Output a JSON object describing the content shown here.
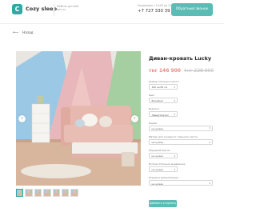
{
  "header": {
    "logo_letter": "C",
    "brand": "Cozy sleep",
    "tagline": "Мебель детской мечты",
    "hours": "Ежедневно с 10:00 до 21:00",
    "phone": "+7 727 330 39 42",
    "cta_label": "Обратный звонок"
  },
  "nav": {
    "back_label": "Назад"
  },
  "gallery": {
    "thumbnail_count": 7,
    "active_thumbnail": 1
  },
  "product": {
    "title": "Диван-кровать Lucky",
    "price_current": "тнг 146 900",
    "price_old": "тнг 238 900",
    "options": [
      {
        "label": "Размер спального места",
        "value": "160 на 80 см",
        "short": true
      },
      {
        "label": "Цвет",
        "value": "Бежевый",
        "short": true
      },
      {
        "label": "Бортики",
        "value": "Левый бортик",
        "short": true
      },
      {
        "label": "Ящики",
        "value": "не нужен",
        "short": false
      },
      {
        "label": "Матрас для основного спального места",
        "value": "не нужен",
        "short": false
      },
      {
        "label": "Передний бортик",
        "value": "не нужен",
        "short": true
      },
      {
        "label": "Вспомогательное выдвижное",
        "value": "не нужен",
        "short": true
      },
      {
        "label": "Подушки декоративные",
        "value": "не нужен",
        "short": false
      }
    ],
    "add_button": "Добавить в корзину"
  },
  "colors": {
    "accent": "#5bbbb5",
    "price": "#e98b83"
  },
  "icons": {
    "back": "arrow-left-icon",
    "prev": "chevron-left-icon",
    "next": "chevron-right-icon",
    "caret": "chevron-down-icon"
  }
}
